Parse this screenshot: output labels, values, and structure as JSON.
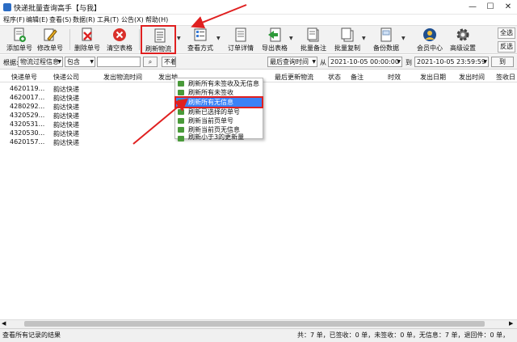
{
  "window": {
    "title": "快递批量查询高手【与我】",
    "min": "—",
    "max": "☐",
    "close": "✕"
  },
  "menu": [
    "程序(F)",
    "编辑(E)",
    "查看(S)",
    "数据(R)",
    "工具(T)",
    "公告(X)",
    "帮助(H)"
  ],
  "toolbar": {
    "add": "添加单号",
    "edit": "修改单号",
    "delete": "删除单号",
    "clear": "清空表格",
    "refresh": "刷新物流",
    "view": "查看方式",
    "detail": "订单详情",
    "export": "导出表格",
    "batch_note": "批量备注",
    "batch_copy": "批量复制",
    "backup": "备份数据",
    "member": "会员中心",
    "settings": "高级设置",
    "select_all": "全选",
    "invert": "反选"
  },
  "filter": {
    "by_label": "根据:",
    "field": "物流过程信息",
    "op": "包含",
    "hidden_sel": "不着",
    "time_field": "最后查询时间",
    "from_label": "从",
    "from": "2021-10-05 00:00:00",
    "to_label": "到",
    "to": "2021-10-05 23:59:59",
    "to_btn": "到"
  },
  "columns": [
    "快递单号",
    "快递公司",
    "发出物流时间",
    "发出地",
    "最后更新物流",
    "状态",
    "备注",
    "时效",
    "发出日期",
    "发出时间",
    "签收日"
  ],
  "rows": [
    {
      "no": "4620119...",
      "co": "韵达快递"
    },
    {
      "no": "4620017...",
      "co": "韵达快递"
    },
    {
      "no": "4280292...",
      "co": "韵达快递"
    },
    {
      "no": "4320529...",
      "co": "韵达快递"
    },
    {
      "no": "4320531...",
      "co": "韵达快递"
    },
    {
      "no": "4320530...",
      "co": "韵达快递"
    },
    {
      "no": "4620157...",
      "co": "韵达快递"
    }
  ],
  "dropdown": [
    "刷新所有未签收及无信息",
    "刷新所有未签收",
    "刷新所有无信息",
    "刷新已选择的单号",
    "刷新当前页单号",
    "刷新当前页无信息",
    "刷新小于3的更新量"
  ],
  "status": {
    "left": "查看所有记录的结果",
    "right": "共：7 单，已签收：0 单，未签收：0 单，无信息：7 单，退回件：0 单，"
  },
  "accent": "#e02020",
  "highlight": "#3b82f6"
}
